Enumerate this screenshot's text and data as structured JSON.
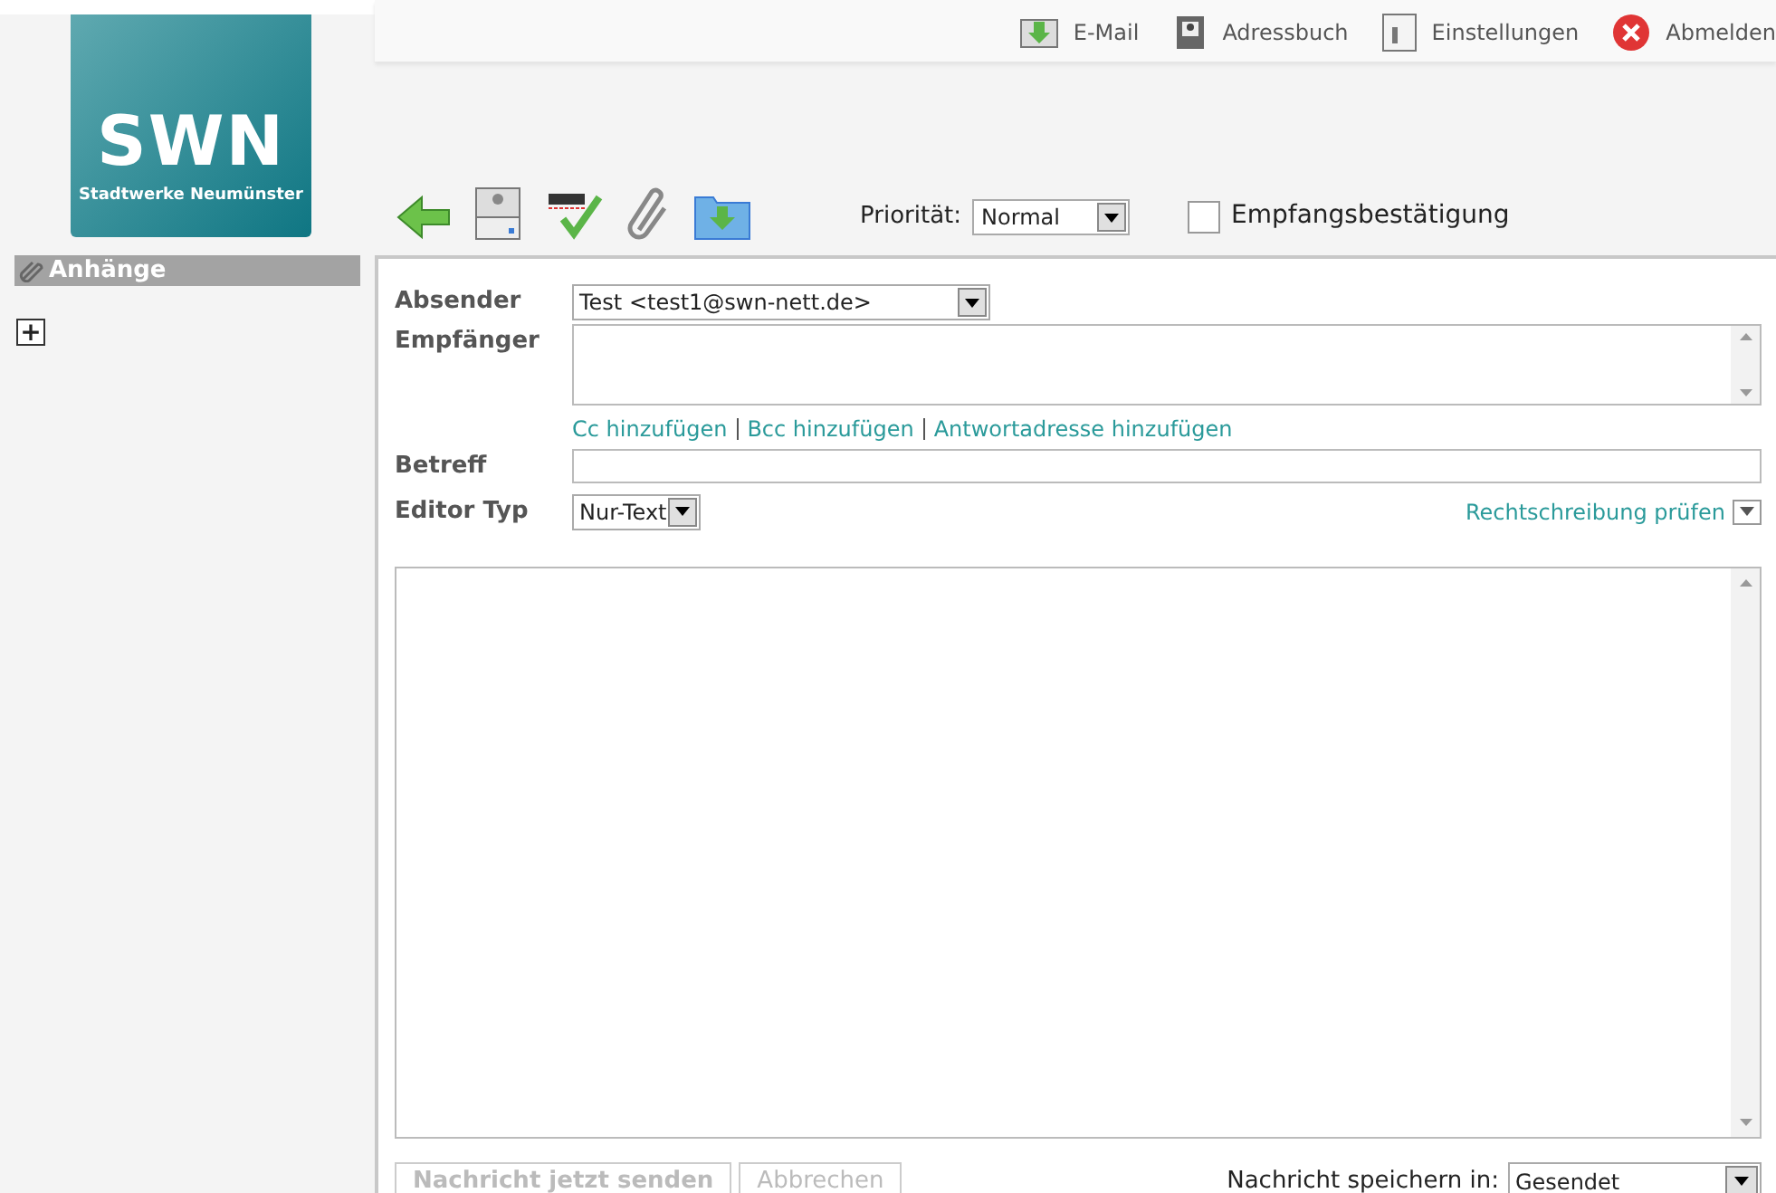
{
  "logo": {
    "title": "SWN",
    "subtitle": "Stadtwerke Neumünster"
  },
  "top_links": [
    {
      "kind": "mail",
      "label": "E-Mail"
    },
    {
      "kind": "book",
      "label": "Adressbuch"
    },
    {
      "kind": "settings",
      "label": "Einstellungen"
    },
    {
      "kind": "logout",
      "label": "Abmelden"
    }
  ],
  "toolbar": {
    "tools": [
      {
        "kind": "back"
      },
      {
        "kind": "print"
      },
      {
        "kind": "spell"
      },
      {
        "kind": "attach"
      },
      {
        "kind": "save"
      }
    ],
    "priority": {
      "label": "Priorität:",
      "value": "Normal"
    },
    "receipt": {
      "label": "Empfangsbestätigung",
      "checked": false
    }
  },
  "sidebar": {
    "title": "Anhänge",
    "add_button": "+"
  },
  "form": {
    "sender": {
      "label": "Absender",
      "value": "Test <test1@swn-nett.de>"
    },
    "recipient": {
      "label": "Empfänger"
    },
    "add_links": [
      "Cc hinzufügen",
      "Bcc hinzufügen",
      "Antwortadresse hinzufügen"
    ],
    "subject": {
      "label": "Betreff"
    },
    "editor_type": {
      "label": "Editor Typ",
      "value": "Nur-Text"
    },
    "spellcheck": "Rechtschreibung prüfen"
  },
  "footer": {
    "buttons": [
      {
        "label": "Nachricht jetzt senden",
        "disabled": true
      },
      {
        "label": "Abbrechen",
        "disabled": true
      }
    ],
    "save_in": {
      "label": "Nachricht speichern in:",
      "value": "Gesendet"
    }
  }
}
